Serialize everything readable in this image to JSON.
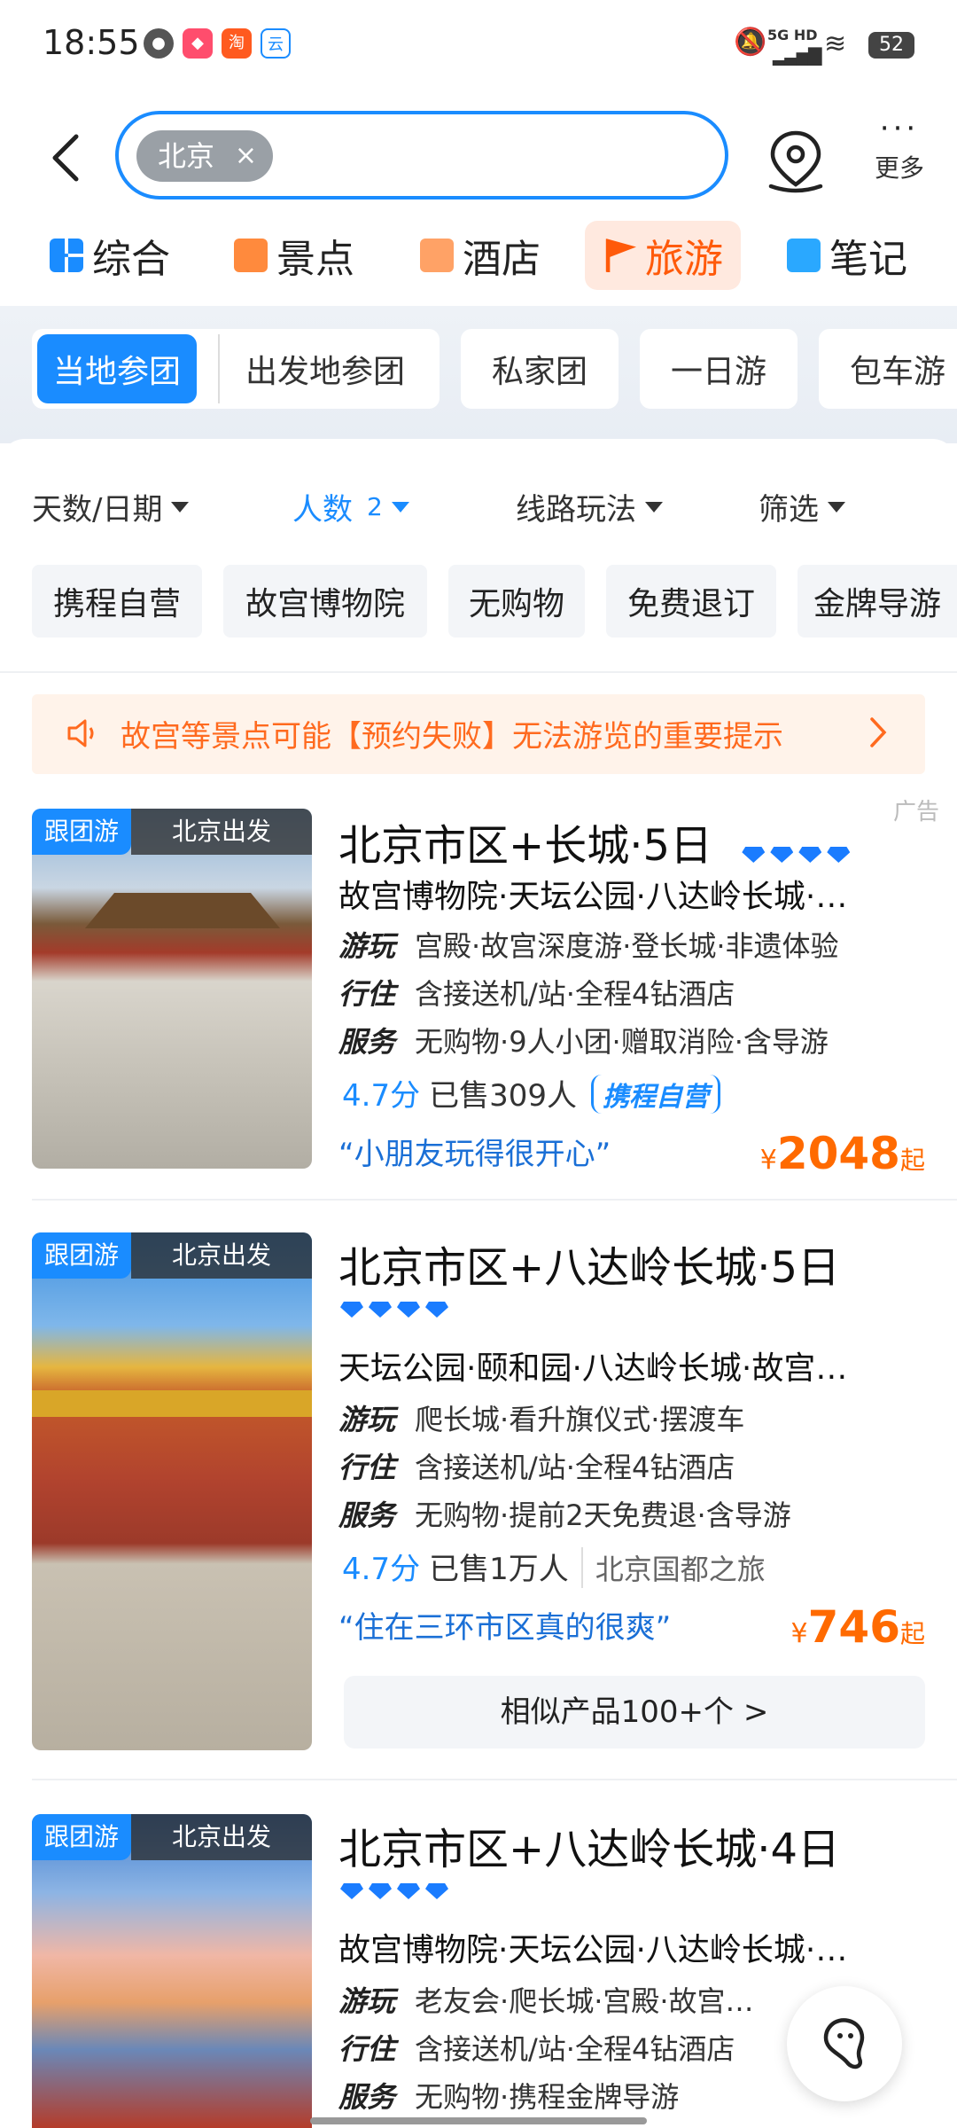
{
  "status": {
    "time": "18:55",
    "battery": "52",
    "network": "5G HD"
  },
  "search": {
    "chip": "北京",
    "chip_close": "×"
  },
  "header": {
    "more": "更多",
    "more_dots": "···"
  },
  "categories": [
    {
      "label": "综合",
      "icon": "grid-icon",
      "color": "#1a8cff"
    },
    {
      "label": "景点",
      "icon": "ticket-icon",
      "color": "#ff8a3d"
    },
    {
      "label": "酒店",
      "icon": "hotel-icon",
      "color": "#ffa266"
    },
    {
      "label": "旅游",
      "icon": "flag-icon",
      "color": "#ff5a0a",
      "active": true
    },
    {
      "label": "笔记",
      "icon": "notebook-icon",
      "color": "#2aa8ff"
    }
  ],
  "subtabs": [
    "当地参团",
    "出发地参团",
    "私家团",
    "一日游",
    "包车游"
  ],
  "filters": {
    "days": "天数/日期",
    "people": "人数",
    "people_count": "2",
    "route": "线路玩法",
    "filter": "筛选"
  },
  "tags": [
    "携程自营",
    "故宫博物院",
    "无购物",
    "免费退订",
    "金牌导游"
  ],
  "notice": "故宫等景点可能【预约失败】无法游览的重要提示",
  "ad_label": "广告",
  "products": [
    {
      "badge": "跟团游",
      "depart": "北京出发",
      "title": "北京市区+长城·5日",
      "diamonds": 4,
      "sights": "故宫博物院·天坛公园·八达岭长城·…",
      "play_k": "游玩",
      "play": "宫殿·故宫深度游·登长城·非遗体验",
      "stay_k": "行住",
      "stay": "含接送机/站·全程4钻酒店",
      "service_k": "服务",
      "service": "无购物·9人小团·赠取消险·含导游",
      "score": "4.7分",
      "sold": "已售309人",
      "extra": "携程自营",
      "quote": "“小朋友玩得很开心”",
      "currency": "¥",
      "price": "2048",
      "unit": "起"
    },
    {
      "badge": "跟团游",
      "depart": "北京出发",
      "title": "北京市区+八达岭长城·5日",
      "diamonds": 4,
      "sights": "天坛公园·颐和园·八达岭长城·故宫…",
      "play_k": "游玩",
      "play": "爬长城·看升旗仪式·摆渡车",
      "stay_k": "行住",
      "stay": "含接送机/站·全程4钻酒店",
      "service_k": "服务",
      "service": "无购物·提前2天免费退·含导游",
      "score": "4.7分",
      "sold": "已售1万人",
      "extra": "北京国都之旅",
      "quote": "“住在三环市区真的很爽”",
      "currency": "¥",
      "price": "746",
      "unit": "起",
      "similar": "相似产品100+个 >"
    },
    {
      "badge": "跟团游",
      "depart": "北京出发",
      "title": "北京市区+八达岭长城·4日",
      "diamonds": 4,
      "sights": "故宫博物院·天坛公园·八达岭长城·…",
      "play_k": "游玩",
      "play": "老友会·爬长城·宫殿·故宫…",
      "stay_k": "行住",
      "stay": "含接送机/站·全程4钻酒店",
      "service_k": "服务",
      "service": "无购物·携程金牌导游"
    }
  ],
  "colors": {
    "accent": "#1a8cff",
    "price": "#ff6a00",
    "notice": "#ff6a1f"
  }
}
